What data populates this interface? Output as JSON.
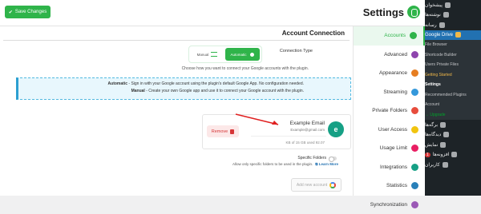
{
  "header": {
    "title": "Settings",
    "save_label": "Save Changes"
  },
  "sidebar": {
    "items": [
      {
        "label": "پیشخوان"
      },
      {
        "label": "نوشته‌ها"
      },
      {
        "label": "رسانه"
      },
      {
        "label": "Google Drive"
      }
    ],
    "sub_items": [
      {
        "label": "File Browser"
      },
      {
        "label": "Shortcode Builder"
      },
      {
        "label": "Users Private Files"
      },
      {
        "label": "Getting Started"
      },
      {
        "label": "Settings"
      },
      {
        "label": "Recommended Plugins"
      },
      {
        "label": "Account"
      },
      {
        "label": "Upgrade →"
      }
    ],
    "bottom_items": [
      {
        "label": "برگه‌ها"
      },
      {
        "label": "دیدگاه‌ها"
      },
      {
        "label": "نمایش"
      },
      {
        "label": "افزونه‌ها",
        "badge": "1"
      },
      {
        "label": "کاربران"
      }
    ]
  },
  "tabs": [
    {
      "label": "Accounts",
      "color": "#2fb44a"
    },
    {
      "label": "Advanced",
      "color": "#8e44ad"
    },
    {
      "label": "Appearance",
      "color": "#e67e22"
    },
    {
      "label": "Streaming",
      "color": "#3498db"
    },
    {
      "label": "Private Folders",
      "color": "#e74c3c"
    },
    {
      "label": "User Access",
      "color": "#f1c40f"
    },
    {
      "label": "Usage Limit",
      "color": "#e91e63"
    },
    {
      "label": "Integrations",
      "color": "#16a085"
    },
    {
      "label": "Statistics",
      "color": "#2980b9"
    },
    {
      "label": "Synchronization",
      "color": "#9b59b6"
    }
  ],
  "main": {
    "section_title": "Account Connection",
    "connection_type_label": "Connection Type",
    "manual_label": "Manual",
    "automatic_label": "Automatic",
    "connection_help": "Choose how you want to connect your Google accounts with the plugin.",
    "info_lines": [
      {
        "bold": "Automatic",
        "text": " - Sign in with your Google account using the plugin's default Google App. No configuration needed."
      },
      {
        "bold": "Manual",
        "text": " - Create your own Google app and use it to connect your Google account with the plugin."
      }
    ],
    "account": {
      "name": "Example Email",
      "email": "Example@gmail.com",
      "avatar_letter": "e",
      "storage": "KB of 15 GB used 92.07",
      "remove_label": "Remove"
    },
    "specific_folders_label": "Specific Folders",
    "specific_folders_help": "Allow only specific folders to be used in the plugin.",
    "learn_more": "Learn More",
    "add_account_placeholder": "Add new account"
  }
}
